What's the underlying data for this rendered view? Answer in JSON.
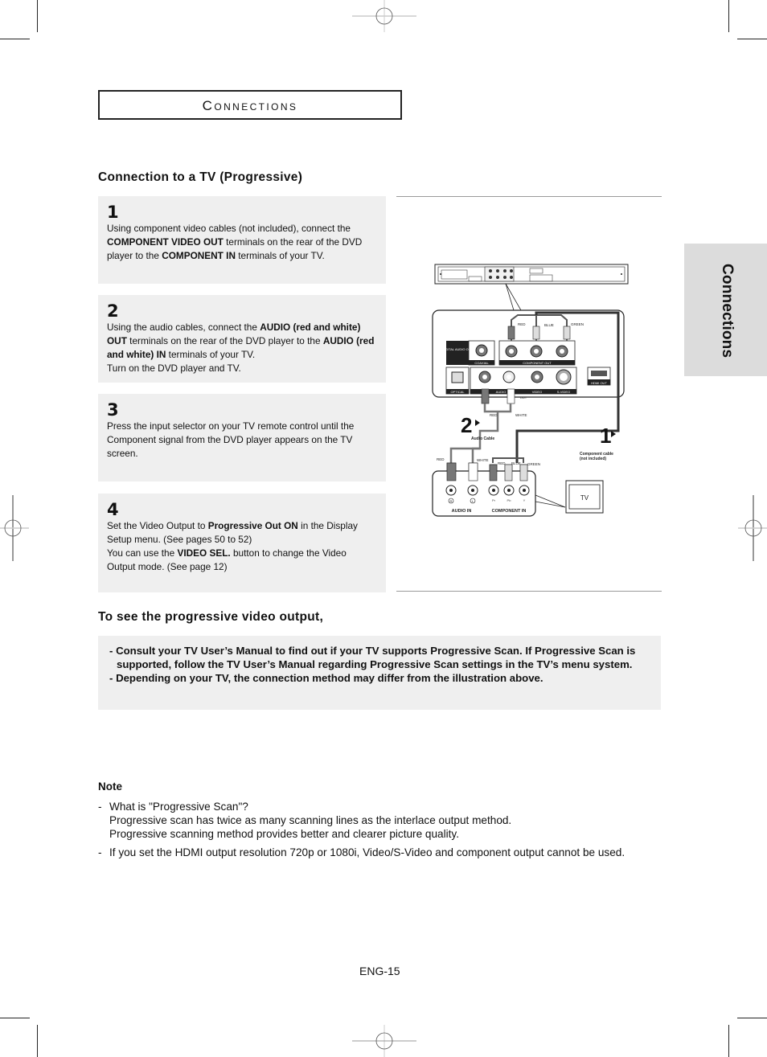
{
  "header": {
    "title": "Connections"
  },
  "side_tab": {
    "label": "Connections"
  },
  "section": {
    "title": "Connection to a TV (Progressive)"
  },
  "steps": [
    {
      "number": "1",
      "parts": [
        {
          "text": "Using component video cables (not included), connect the ",
          "bold": false
        },
        {
          "text": "COMPONENT VIDEO OUT",
          "bold": true
        },
        {
          "text": " terminals on the rear of the DVD player to the ",
          "bold": false
        },
        {
          "text": "COMPONENT IN",
          "bold": true
        },
        {
          "text": " terminals of your TV.",
          "bold": false
        }
      ]
    },
    {
      "number": "2",
      "parts": [
        {
          "text": "Using the audio cables, connect the ",
          "bold": false
        },
        {
          "text": "AUDIO (red and white) OUT",
          "bold": true
        },
        {
          "text": " terminals on the rear of the DVD player to the ",
          "bold": false
        },
        {
          "text": "AUDIO (red and white) IN",
          "bold": true
        },
        {
          "text": " terminals of your TV.",
          "bold": false
        },
        {
          "text": "\nTurn on the DVD player and TV.",
          "bold": false
        }
      ]
    },
    {
      "number": "3",
      "parts": [
        {
          "text": "Press the input selector on your TV remote control until the Component signal from the DVD player appears on the TV screen.",
          "bold": false
        }
      ]
    },
    {
      "number": "4",
      "parts": [
        {
          "text": "Set the Video Output to ",
          "bold": false
        },
        {
          "text": "Progressive Out ON",
          "bold": true
        },
        {
          "text": " in the Display Setup menu. (See pages 50 to 52)",
          "bold": false
        },
        {
          "text": "\nYou can use the ",
          "bold": false
        },
        {
          "text": "VIDEO SEL.",
          "bold": true
        },
        {
          "text": " button to change the Video Output mode. (See page 12)",
          "bold": false
        }
      ]
    }
  ],
  "diagram": {
    "dvd_panel": {
      "digital_audio_out": "DIGITAL AUDIO OUT",
      "coaxial": "COAXIAL",
      "component_out": "COMPONENT OUT",
      "optical": "OPTICAL",
      "audio": "AUDIO",
      "video": "VIDEO",
      "s_video": "S-VIDEO",
      "out": "OUT",
      "hdmi_out": "HDMI OUT"
    },
    "cable_labels": {
      "red": "RED",
      "blue": "BLUE",
      "green": "GREEN",
      "white": "WHITE",
      "audio_cable": "Audio Cable",
      "component_cable_line1": "Component cable",
      "component_cable_line2": "(not included)"
    },
    "step_markers": [
      "2",
      "1"
    ],
    "tv_panel": {
      "audio_in": "AUDIO IN",
      "component_in": "COMPONENT IN",
      "r": "R",
      "l": "L",
      "pr": "Pr",
      "pb": "Pb",
      "y": "Y"
    },
    "tv_label": "TV"
  },
  "progressive": {
    "title": "To see the progressive video output,",
    "items": [
      "Consult your TV User’s Manual to find out if your TV supports Progressive Scan. If Progressive Scan is supported, follow the TV User’s Manual regarding Progressive Scan settings in the TV’s menu system.",
      "Depending on your TV, the connection method may differ from the illustration above."
    ]
  },
  "note": {
    "title": "Note",
    "items": [
      {
        "lines": [
          "What is \"Progressive Scan\"?",
          "Progressive scan has twice as many scanning lines as the interlace output method.",
          "Progressive scanning method provides better and clearer picture quality."
        ]
      },
      {
        "lines": [
          "If you set the HDMI output resolution 720p or 1080i, Video/S-Video and component output cannot be used."
        ]
      }
    ]
  },
  "footer": {
    "page_number": "ENG-15"
  }
}
